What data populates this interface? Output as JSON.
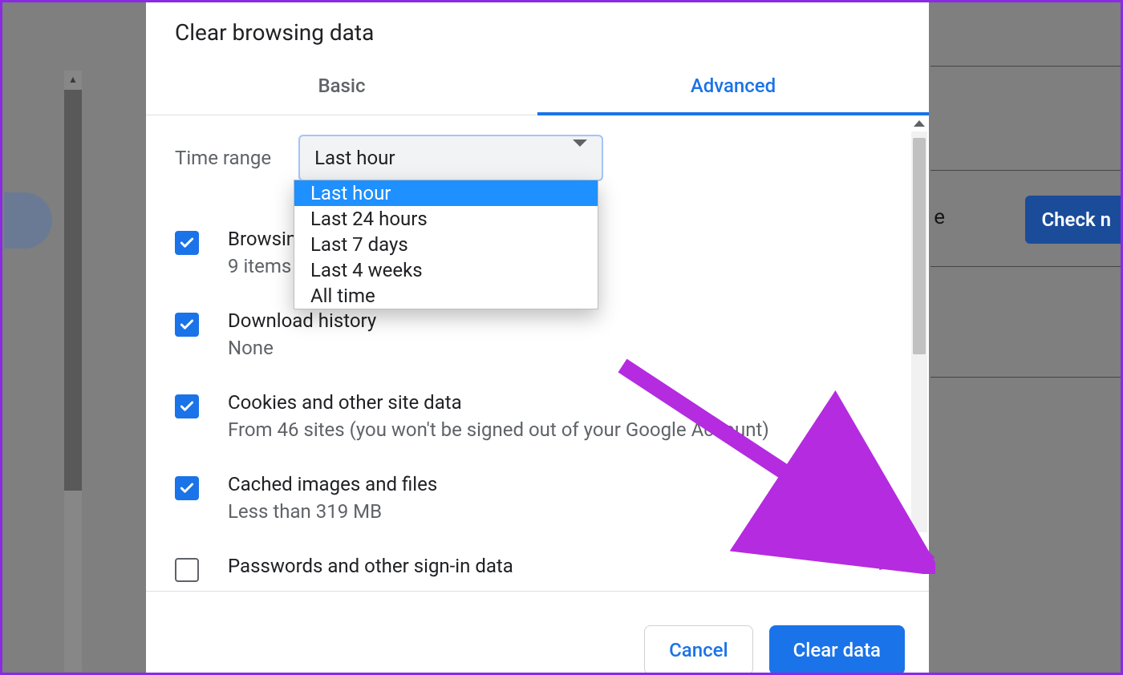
{
  "dialog": {
    "title": "Clear browsing data",
    "tabs": {
      "basic": "Basic",
      "advanced": "Advanced",
      "active": "advanced"
    },
    "timeRange": {
      "label": "Time range",
      "selected": "Last hour",
      "options": [
        "Last hour",
        "Last 24 hours",
        "Last 7 days",
        "Last 4 weeks",
        "All time"
      ]
    },
    "items": [
      {
        "title": "Browsing history",
        "subtitle": "9 items",
        "checked": true
      },
      {
        "title": "Download history",
        "subtitle": "None",
        "checked": true
      },
      {
        "title": "Cookies and other site data",
        "subtitle": "From 46 sites (you won't be signed out of your Google Account)",
        "checked": true
      },
      {
        "title": "Cached images and files",
        "subtitle": "Less than 319 MB",
        "checked": true
      },
      {
        "title": "Passwords and other sign-in data",
        "subtitle": "",
        "checked": false
      }
    ],
    "buttons": {
      "cancel": "Cancel",
      "clear": "Clear data"
    }
  },
  "bg": {
    "check_button": "Check n",
    "right_char": "e"
  }
}
